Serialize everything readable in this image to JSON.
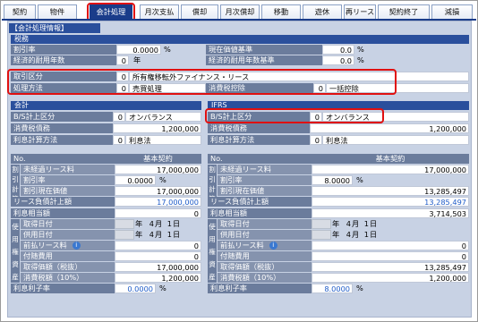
{
  "tabs": [
    {
      "label": "契約"
    },
    {
      "label": "物件"
    },
    {
      "label": "会計処理"
    },
    {
      "label": "月次支払"
    },
    {
      "label": "償却"
    },
    {
      "label": "月次償却"
    },
    {
      "label": "移動"
    },
    {
      "label": "遊休"
    },
    {
      "label": "再リース"
    },
    {
      "label": "契約終了"
    },
    {
      "label": "減損"
    }
  ],
  "active_tab": "会計処理",
  "section_title": "【会計処理情報】",
  "tax": {
    "header": "税務",
    "discount_rate_label": "割引率",
    "discount_rate": "0.0000",
    "discount_unit": "%",
    "useful_life_label": "経済的耐用年数",
    "useful_life": "0",
    "useful_life_unit": "年",
    "pv_standard_label": "現在価値基準",
    "pv_standard": "0.0",
    "pv_unit": "%",
    "life_standard_label": "経済的耐用年数基準",
    "life_standard": "0.0",
    "life_unit": "%",
    "transaction_label": "取引区分",
    "transaction_code": "0",
    "transaction_text": "所有権移転外ファイナンス・リース",
    "method_label": "処理方法",
    "method_code": "0",
    "method_text": "売買処理",
    "consumption_tax_label": "消費税控除",
    "consumption_tax_code": "0",
    "consumption_tax_text": "一括控除"
  },
  "accounting": {
    "header": "会計",
    "bs_label": "B/S計上区分",
    "bs_code": "0",
    "bs_text": "オンバランス",
    "tax_debt_label": "消費税債務",
    "tax_debt": "1,200,000",
    "interest_label": "利息計算方法",
    "interest_code": "0",
    "interest_text": "利息法"
  },
  "ifrs": {
    "header": "IFRS",
    "bs_label": "B/S計上区分",
    "bs_code": "0",
    "bs_text": "オンバランス",
    "tax_debt_label": "消費税債務",
    "tax_debt": "1,200,000",
    "interest_label": "利息計算方法",
    "interest_code": "0",
    "interest_text": "利息法"
  },
  "common_labels": {
    "no": "No.",
    "basic_contract": "基本契約",
    "v1": [
      "割",
      "引",
      "計",
      "算"
    ],
    "unexpired": "未経過リース料",
    "rate": "割引率",
    "pv": "割引現在価値",
    "liability": "リース負債計上額",
    "interest": "利息相当額",
    "v2": [
      "使",
      "用",
      "権",
      "資",
      "産"
    ],
    "acq_date": "取得日付",
    "use_date": "供用日付",
    "prepaid": "前払リース料",
    "incidental": "付随費用",
    "acq_cost": "取得価額（税抜）",
    "tax10": "消費税額（10%）",
    "interest_rate": "利息利子率",
    "year_unit": "年",
    "month_unit": "月",
    "day_unit": "日",
    "pct": "%"
  },
  "left_detail": {
    "unexpired": "17,000,000",
    "rate": "0.0000",
    "pv": "17,000,000",
    "liability": "17,000,000",
    "interest": "0",
    "acq_year": "",
    "acq_month": "4",
    "acq_day": "1",
    "use_year": "",
    "use_month": "4",
    "use_day": "1",
    "prepaid": "0",
    "incidental": "0",
    "acq_cost": "17,000,000",
    "tax10": "1,200,000",
    "interest_rate": "0.0000"
  },
  "right_detail": {
    "unexpired": "17,000,000",
    "rate": "8.0000",
    "pv": "13,285,497",
    "liability": "13,285,497",
    "interest": "3,714,503",
    "acq_year": "",
    "acq_month": "4",
    "acq_day": "1",
    "use_year": "",
    "use_month": "4",
    "use_day": "1",
    "prepaid": "0",
    "incidental": "0",
    "acq_cost": "13,285,497",
    "tax10": "1,200,000",
    "interest_rate": "8.0000"
  }
}
